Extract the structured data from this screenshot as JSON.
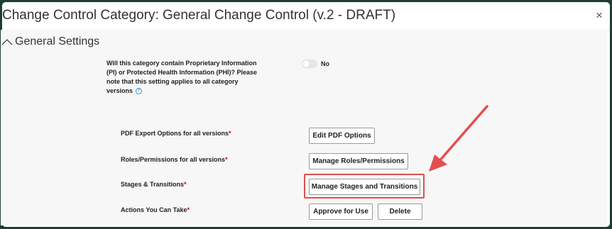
{
  "dialog": {
    "title": "Change Control Category: General Change Control (v.2 - DRAFT)",
    "close_glyph": "×"
  },
  "section": {
    "title": "General Settings",
    "toggle_icon": "chevron-up-icon"
  },
  "pi_setting": {
    "label": "Will this category contain Proprietary Information (PI) or Protected Health Information (PHI)? Please note that this setting applies to all category versions",
    "help_glyph": "?",
    "toggle_state": "No"
  },
  "rows": {
    "pdf": {
      "label": "PDF Export Options for all versions",
      "required": "*",
      "button": "Edit PDF Options"
    },
    "roles": {
      "label": "Roles/Permissions for all versions",
      "required": "*",
      "button": "Manage Roles/Permissions"
    },
    "stages": {
      "label": "Stages & Transitions",
      "required": "*",
      "button": "Manage Stages and Transitions"
    },
    "actions": {
      "label": "Actions You Can Take",
      "required": "*",
      "approve_button": "Approve for Use",
      "delete_button": "Delete"
    }
  },
  "colors": {
    "frame_background": "#1f3d33",
    "annotation_red": "#e24f4f",
    "required_red": "#d0021b",
    "help_blue": "#3a8dde"
  }
}
